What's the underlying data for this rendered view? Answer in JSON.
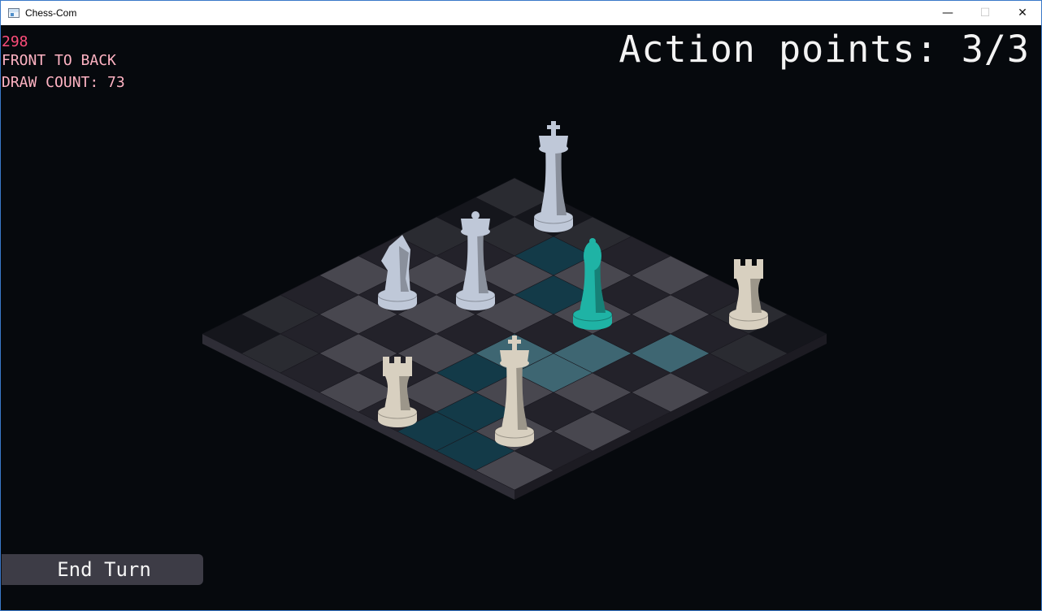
{
  "window": {
    "title": "Chess-Com",
    "minimize_glyph": "—",
    "maximize_glyph": "☐",
    "close_glyph": "✕"
  },
  "debug": {
    "fps": "298",
    "sort_mode": "FRONT TO BACK",
    "draw_count": "DRAW COUNT: 73"
  },
  "hud": {
    "action_points": "Action points: 3/3"
  },
  "controls": {
    "end_turn_label": "End Turn"
  },
  "colors": {
    "background": "#06090d",
    "tile_dark": "#23222a",
    "tile_light": "#48474f",
    "tile_highlight_light": "#3e6672",
    "tile_highlight_dark": "#133a48",
    "piece_white": "#bfc8d8",
    "piece_ivory": "#d8d0c0",
    "piece_selected": "#1fb3a5",
    "fps_text": "#ff4d7a",
    "debug_text": "#ffb3c3",
    "button_bg": "#3d3c46"
  },
  "board": {
    "files": 8,
    "ranks": 8,
    "highlighted_light": [
      [
        6,
        2
      ],
      [
        5,
        3
      ],
      [
        4,
        4
      ],
      [
        5,
        4
      ]
    ],
    "highlighted_dark": [
      [
        2,
        1
      ],
      [
        3,
        2
      ],
      [
        4,
        5
      ],
      [
        5,
        6
      ],
      [
        5,
        7
      ],
      [
        6,
        7
      ]
    ],
    "pieces": [
      {
        "name": "queen",
        "color": "white",
        "file": 2,
        "rank": 3,
        "icon": "queen-icon"
      },
      {
        "name": "knight",
        "color": "white",
        "file": 1,
        "rank": 4,
        "icon": "knight-icon"
      },
      {
        "name": "king",
        "color": "white",
        "file": 1,
        "rank": 0,
        "icon": "king-icon"
      },
      {
        "name": "bishop",
        "color": "selected",
        "file": 4,
        "rank": 2,
        "icon": "bishop-icon"
      },
      {
        "name": "rook",
        "color": "ivory",
        "file": 4,
        "rank": 7,
        "icon": "rook-icon"
      },
      {
        "name": "king",
        "color": "ivory",
        "file": 6,
        "rank": 6,
        "icon": "king-icon"
      },
      {
        "name": "rook",
        "color": "ivory",
        "file": 6,
        "rank": 0,
        "icon": "rook-icon"
      }
    ]
  }
}
